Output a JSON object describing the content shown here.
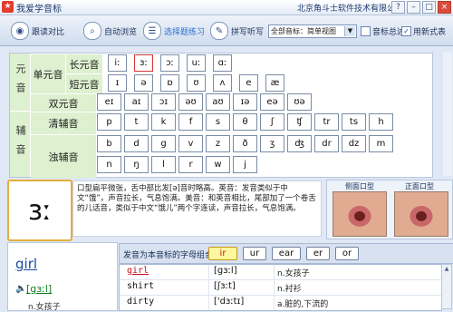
{
  "window": {
    "title": "我爱学音标",
    "company": "北京角斗士软件技术有限公司",
    "buttons": [
      "?",
      "–",
      "□",
      "×"
    ]
  },
  "toolbar": {
    "buttons": [
      {
        "label": "跟读对比",
        "icon": "mic-icon"
      },
      {
        "label": "自动浏览",
        "icon": "magnifier-icon"
      },
      {
        "label": "选择题练习",
        "icon": "quiz-icon"
      },
      {
        "label": "拼写听写",
        "icon": "pencil-icon"
      }
    ],
    "mode_select": "全部音标：简单视图",
    "checkbox_review": "音标总述",
    "checkbox_newtable": "用新式表",
    "newtable_checked": "✓"
  },
  "phonetics": {
    "vowel_category": "元音",
    "consonant_category": "辅音",
    "monophthong": "单元音",
    "long_vowel": "长元音",
    "short_vowel": "短元音",
    "diphthong": "双元音",
    "voiceless": "清辅音",
    "voiced": "浊辅音",
    "long": [
      "iː",
      "ɜː",
      "ɔː",
      "uː",
      "ɑː"
    ],
    "short": [
      "ɪ",
      "ə",
      "ɒ",
      "ʊ",
      "ʌ",
      "e",
      "æ"
    ],
    "diph": [
      "eɪ",
      "aɪ",
      "ɔɪ",
      "əʊ",
      "aʊ",
      "ɪə",
      "eə",
      "ʊə"
    ],
    "unvoiced": [
      "p",
      "t",
      "k",
      "f",
      "s",
      "θ",
      "ʃ",
      "ʧ",
      "tr",
      "ts",
      "h"
    ],
    "voiced_row1": [
      "b",
      "d",
      "g",
      "v",
      "z",
      "ð",
      "ʒ",
      "ʤ",
      "dr",
      "dz",
      "m"
    ],
    "voiced_row2": [
      "n",
      "ŋ",
      "l",
      "r",
      "w",
      "j"
    ],
    "selected": "ɜː"
  },
  "detail": {
    "symbol": "ɜː",
    "description": "口型扁平微张，舌中部比发[ə]音时略高。英音：发音类似于中文“饿”，声音拉长，气息饱满。美音：和英音相比，尾部加了一个卷舌的儿话音，类似于中文“饿儿”两个字连读，声音拉长，气息饱满。",
    "side_label": "侧面口型",
    "front_label": "正面口型"
  },
  "example": {
    "word": "girl",
    "speaker_icon": "🔈",
    "ipa": "[gɜːl]",
    "meaning": "n.女孩子"
  },
  "combos": {
    "label": "发音为本音标的字母组合：",
    "items": [
      "ir",
      "ur",
      "ear",
      "er",
      "or"
    ],
    "selected": "ir"
  },
  "words": [
    {
      "word": "girl",
      "ipa": "[gɜːl]",
      "meaning": "n.女孩子"
    },
    {
      "word": "shirt",
      "ipa": "[ʃɜːt]",
      "meaning": "n.衬衫"
    },
    {
      "word": "dirty",
      "ipa": "['dɜːtɪ]",
      "meaning": "a.脏的,下流的"
    }
  ]
}
